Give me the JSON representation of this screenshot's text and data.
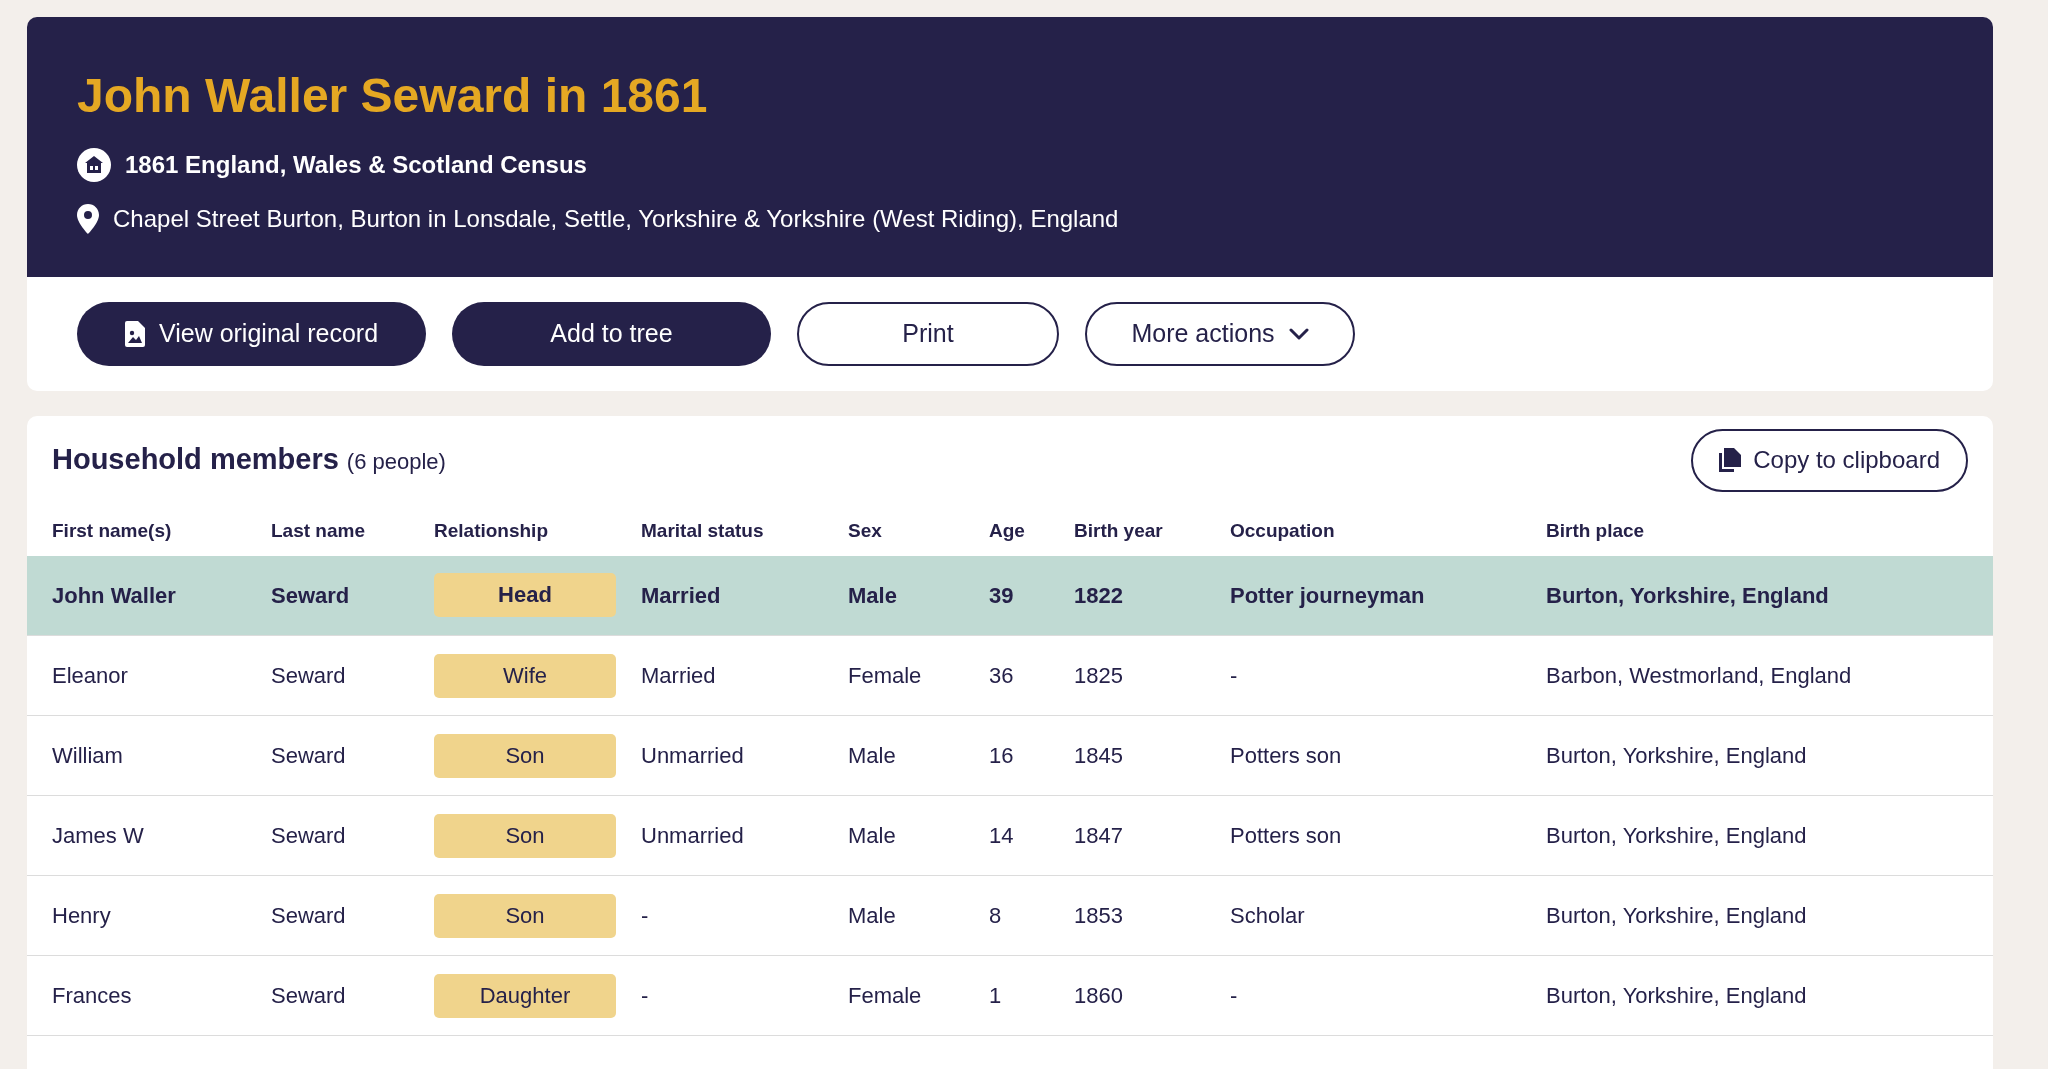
{
  "header": {
    "title": "John Waller Seward in 1861",
    "collection": "1861 England, Wales & Scotland Census",
    "address": "Chapel Street Burton, Burton in Lonsdale, Settle, Yorkshire & Yorkshire (West Riding), England"
  },
  "actions": [
    {
      "label": "View original record",
      "kind": "primary-icon"
    },
    {
      "label": "Add to tree",
      "kind": "primary"
    },
    {
      "label": "Print",
      "kind": "outline"
    },
    {
      "label": "More actions",
      "kind": "dropdown"
    }
  ],
  "household": {
    "title": "Household members",
    "count": "(6 people)",
    "copy_button": "Copy to clipboard",
    "columns": [
      "First name(s)",
      "Last name",
      "Relationship",
      "Marital status",
      "Sex",
      "Age",
      "Birth year",
      "Occupation",
      "Birth place"
    ],
    "rows": [
      {
        "selected": true,
        "cells": [
          "John Waller",
          "Seward",
          "Head",
          "Married",
          "Male",
          "39",
          "1822",
          "Potter journeyman",
          "Burton, Yorkshire, England"
        ]
      },
      {
        "selected": false,
        "cells": [
          "Eleanor",
          "Seward",
          "Wife",
          "Married",
          "Female",
          "36",
          "1825",
          "-",
          "Barbon, Westmorland, England"
        ]
      },
      {
        "selected": false,
        "cells": [
          "William",
          "Seward",
          "Son",
          "Unmarried",
          "Male",
          "16",
          "1845",
          "Potters son",
          "Burton, Yorkshire, England"
        ]
      },
      {
        "selected": false,
        "cells": [
          "James W",
          "Seward",
          "Son",
          "Unmarried",
          "Male",
          "14",
          "1847",
          "Potters son",
          "Burton, Yorkshire, England"
        ]
      },
      {
        "selected": false,
        "cells": [
          "Henry",
          "Seward",
          "Son",
          "-",
          "Male",
          "8",
          "1853",
          "Scholar",
          "Burton, Yorkshire, England"
        ]
      },
      {
        "selected": false,
        "cells": [
          "Frances",
          "Seward",
          "Daughter",
          "-",
          "Female",
          "1",
          "1860",
          "-",
          "Burton, Yorkshire, England"
        ]
      }
    ]
  }
}
